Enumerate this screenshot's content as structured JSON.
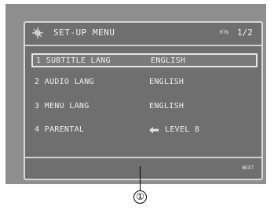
{
  "menu": {
    "icon": "gear-icon",
    "title": "SET-UP MENU",
    "page_label": "RTN",
    "page": "1/2",
    "items": [
      {
        "label": "1 SUBTITLE LANG",
        "value": "ENGLISH",
        "selected": true
      },
      {
        "label": "2 AUDIO LANG",
        "value": "ENGLISH"
      },
      {
        "label": "3 MENU LANG",
        "value": "ENGLISH"
      },
      {
        "label": "4 PARENTAL",
        "value": "LEVEL 8",
        "icon": "arrow-left-icon"
      }
    ],
    "next_label": "NEXT"
  },
  "callout": {
    "number": "①"
  }
}
